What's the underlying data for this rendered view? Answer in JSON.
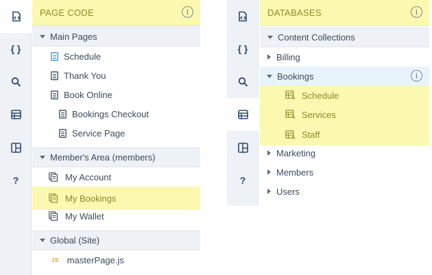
{
  "left_panel": {
    "header": "PAGE CODE",
    "sections": [
      {
        "label": "Main Pages"
      },
      {
        "label": "Member's Area (members)"
      },
      {
        "label": "Global (Site)"
      }
    ],
    "main_pages": [
      "Schedule",
      "Thank You",
      "Book Online",
      "Bookings Checkout",
      "Service Page"
    ],
    "members_pages": [
      "My Account",
      "My Bookings",
      "My Wallet"
    ],
    "global_files": [
      {
        "icon": "JS",
        "label": "masterPage.js"
      }
    ]
  },
  "right_panel": {
    "header": "DATABASES",
    "section": "Content Collections",
    "collections": [
      "Billing",
      "Bookings",
      "Marketing",
      "Members",
      "Users"
    ],
    "bookings_children": [
      "Schedule",
      "Services",
      "Staff"
    ]
  },
  "rail": {
    "items": [
      {
        "icon": "page-code-icon"
      },
      {
        "icon": "code-braces-icon",
        "label": "{ }"
      },
      {
        "icon": "search-icon"
      },
      {
        "icon": "database-icon"
      },
      {
        "icon": "dashboard-icon"
      },
      {
        "icon": "help-icon",
        "label": "?"
      }
    ]
  },
  "info_symbol": "i",
  "colors": {
    "highlight": "#fbf8b0",
    "selected": "#e8f4fc",
    "rail": "#eef1f5"
  }
}
